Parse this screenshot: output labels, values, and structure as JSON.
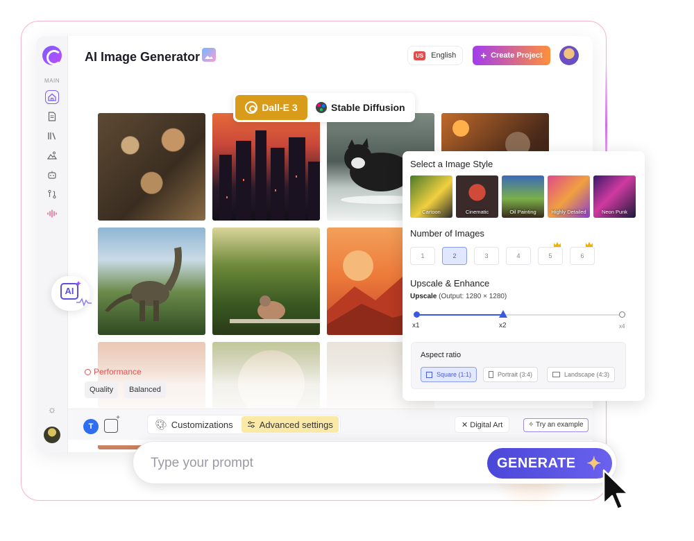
{
  "app": {
    "title": "AI Image Generator"
  },
  "sidebar": {
    "section_label": "MAIN",
    "items": [
      {
        "icon": "home-icon",
        "active": true
      },
      {
        "icon": "document-icon"
      },
      {
        "icon": "library-icon"
      },
      {
        "icon": "image-icon"
      },
      {
        "icon": "bot-icon"
      },
      {
        "icon": "workflow-icon"
      },
      {
        "icon": "voice-wave-icon"
      }
    ]
  },
  "header": {
    "language_flag": "US",
    "language": "English",
    "create_project": "Create Project"
  },
  "models": {
    "tabs": [
      {
        "label": "Dall-E 3",
        "icon": "openai-icon",
        "active": true
      },
      {
        "label": "Stable Diffusion",
        "icon": "palette-icon",
        "active": false
      }
    ]
  },
  "gallery": {
    "images": [
      "gallery-wall-room",
      "neon-city-skyline",
      "cat-running-water",
      "man-with-lamp",
      "dinosaur-forest",
      "pigeon-in-garden",
      "sunset-mountains",
      "faded-portrait",
      "planet-landscape",
      "misty-hills"
    ]
  },
  "performance": {
    "label": "Performance",
    "options": [
      "Quality",
      "Balanced"
    ]
  },
  "style_panel": {
    "style_heading": "Select a Image Style",
    "styles": [
      "Cartoon",
      "Cinematic",
      "Oil Painting",
      "Highly Detailed",
      "Neon Punk"
    ],
    "count_heading": "Number of Images",
    "counts": [
      "1",
      "2",
      "3",
      "4",
      "5",
      "6"
    ],
    "selected_count": "2",
    "premium_counts": [
      "5",
      "6"
    ],
    "upscale_heading": "Upscale & Enhance",
    "upscale_label": "Upscale",
    "upscale_output": "(Output: 1280 × 1280)",
    "upscale_ticks": [
      "x1",
      "x2",
      "x4"
    ],
    "upscale_selected": "x2",
    "aspect_heading": "Aspect ratio",
    "aspects": [
      "Square (1:1)",
      "Portrait (3:4)",
      "Landscape (4:3)"
    ],
    "aspect_selected": "Square (1:1)"
  },
  "toolbar": {
    "text_mode": "T",
    "customizations": "Customizations",
    "advanced_settings": "Advanced settings",
    "digital_art": "Digital Art",
    "try_example": "Try an example"
  },
  "prompt": {
    "placeholder": "Type your prompt",
    "generate": "GENERATE"
  },
  "badge": {
    "ai": "AI"
  },
  "colors": {
    "accent": "#5b4fe0",
    "dalle_active": "#d89c1a",
    "create_gradient_start": "#a23cf0",
    "create_gradient_end": "#ff8f3a",
    "performance": "#e05555"
  }
}
